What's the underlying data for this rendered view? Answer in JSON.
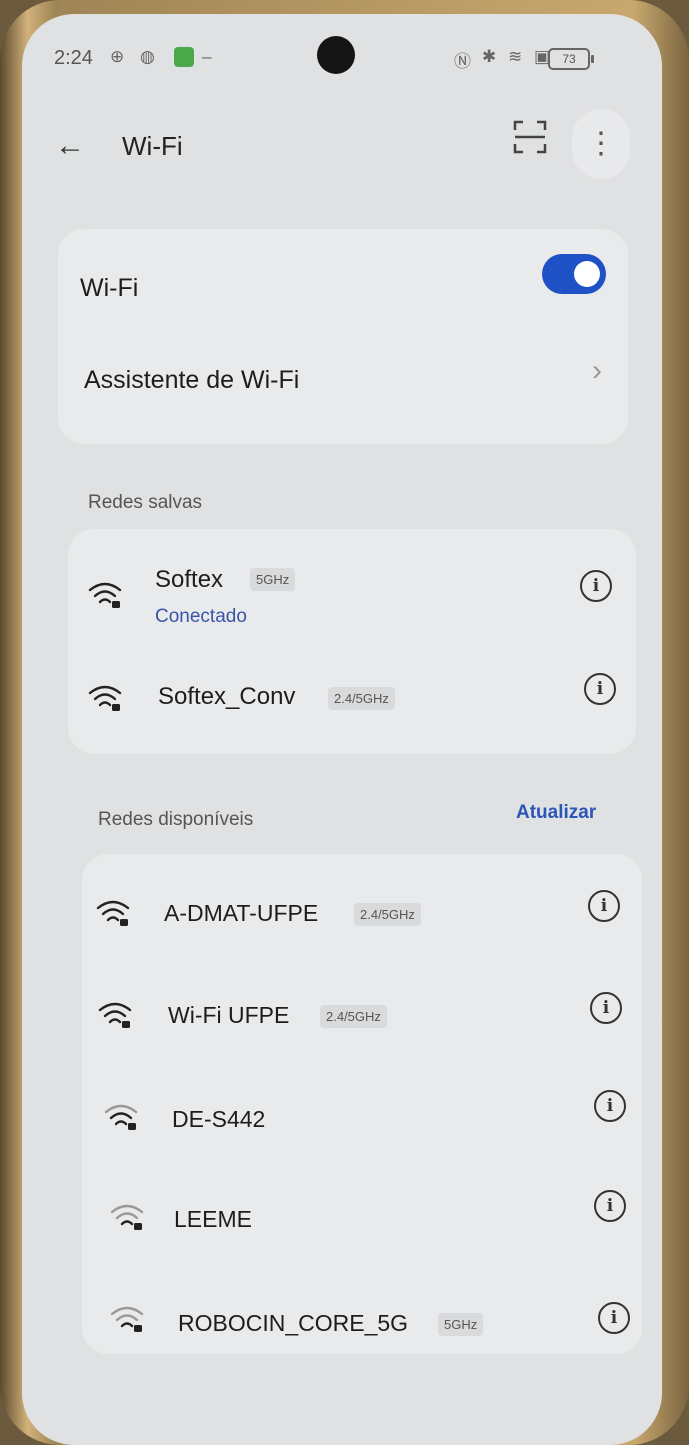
{
  "status_bar": {
    "time": "2:24",
    "battery": "73"
  },
  "header": {
    "title": "Wi-Fi"
  },
  "toggles": {
    "wifi_label": "Wi-Fi",
    "assistant_label": "Assistente de Wi-Fi",
    "wifi_enabled": true
  },
  "saved": {
    "section_label": "Redes salvas",
    "networks": [
      {
        "name": "Softex",
        "band": "5GHz",
        "status": "Conectado"
      },
      {
        "name": "Softex_Conv",
        "band": "2.4/5GHz",
        "status": ""
      }
    ]
  },
  "available": {
    "section_label": "Redes disponíveis",
    "refresh_label": "Atualizar",
    "networks": [
      {
        "name": "A-DMAT-UFPE",
        "band": "2.4/5GHz"
      },
      {
        "name": "Wi-Fi UFPE",
        "band": "2.4/5GHz"
      },
      {
        "name": "DE-S442",
        "band": ""
      },
      {
        "name": "LEEME",
        "band": ""
      },
      {
        "name": "ROBOCIN_CORE_5G",
        "band": "5GHz"
      }
    ]
  },
  "icons": {
    "back": "back-arrow-icon",
    "scan": "scan-icon",
    "more": "more-vertical-icon",
    "wifi": "wifi-lock-icon",
    "info": "info-icon",
    "chevron": "chevron-right-icon"
  },
  "colors": {
    "accent": "#1e50c6",
    "background": "#dfe1e2"
  }
}
